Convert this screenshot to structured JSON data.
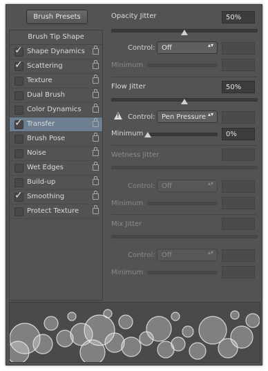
{
  "presets_button": "Brush Presets",
  "sidebar": {
    "header": "Brush Tip Shape",
    "items": [
      {
        "label": "Shape Dynamics",
        "checked": true
      },
      {
        "label": "Scattering",
        "checked": true
      },
      {
        "label": "Texture",
        "checked": false
      },
      {
        "label": "Dual Brush",
        "checked": false
      },
      {
        "label": "Color Dynamics",
        "checked": false
      },
      {
        "label": "Transfer",
        "checked": true,
        "selected": true
      },
      {
        "label": "Brush Pose",
        "checked": false
      },
      {
        "label": "Noise",
        "checked": false
      },
      {
        "label": "Wet Edges",
        "checked": false
      },
      {
        "label": "Build-up",
        "checked": false
      },
      {
        "label": "Smoothing",
        "checked": true
      },
      {
        "label": "Protect Texture",
        "checked": false
      }
    ]
  },
  "opacity": {
    "title": "Opacity Jitter",
    "value": "50%",
    "control_label": "Control:",
    "control_value": "Off",
    "minimum_label": "Minimum"
  },
  "flow": {
    "title": "Flow Jitter",
    "value": "50%",
    "control_label": "Control:",
    "control_value": "Pen Pressure",
    "minimum_label": "Minimum",
    "minimum_value": "0%",
    "warning": "!"
  },
  "wetness": {
    "title": "Wetness Jitter",
    "control_label": "Control:",
    "control_value": "Off",
    "minimum_label": "Minimum"
  },
  "mix": {
    "title": "Mix Jitter",
    "control_label": "Control:",
    "control_value": "Off",
    "minimum_label": "Minimum"
  },
  "icons": {
    "checkmark": "✓",
    "lock": "lock-icon",
    "dropdown_arrows": "▴▾"
  }
}
